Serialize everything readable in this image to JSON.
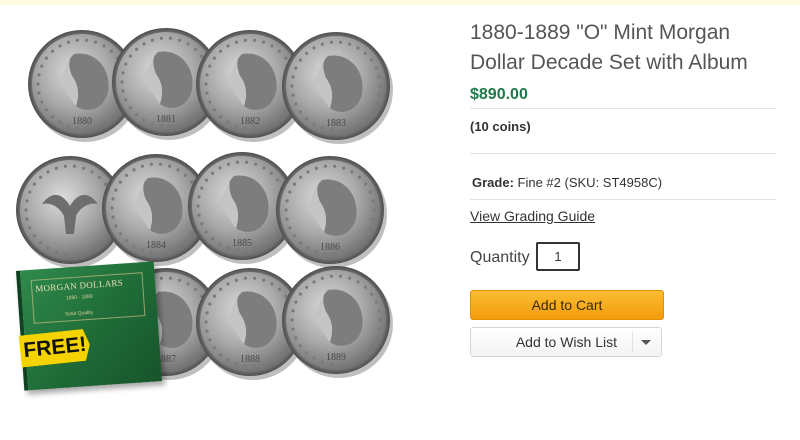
{
  "product": {
    "title": "1880-1889 \"O\" Mint Morgan Dollar Decade Set with Album",
    "price": "$890.00",
    "coin_count": "(10 coins)",
    "grade_label": "Grade:",
    "grade_value": "Fine #2 (SKU: ST4958C)",
    "grading_guide_link": "View Grading Guide",
    "quantity_label": "Quantity",
    "quantity_value": "1",
    "add_to_cart": "Add to Cart",
    "add_to_wishlist": "Add to Wish List"
  },
  "image": {
    "badge": "FREE!",
    "album_title": "MORGAN DOLLARS",
    "album_years": "1880 - 1889",
    "album_sub": "Solid Quality",
    "coin_dates": [
      "1880",
      "1881",
      "1882",
      "1883",
      "",
      "1884",
      "1885",
      "1886",
      "1887",
      "1888",
      "1889"
    ]
  },
  "colors": {
    "price": "#1f7a4a",
    "cart_button": "#f8ab1c",
    "album": "#2f8a4c",
    "badge": "#f4d300"
  }
}
